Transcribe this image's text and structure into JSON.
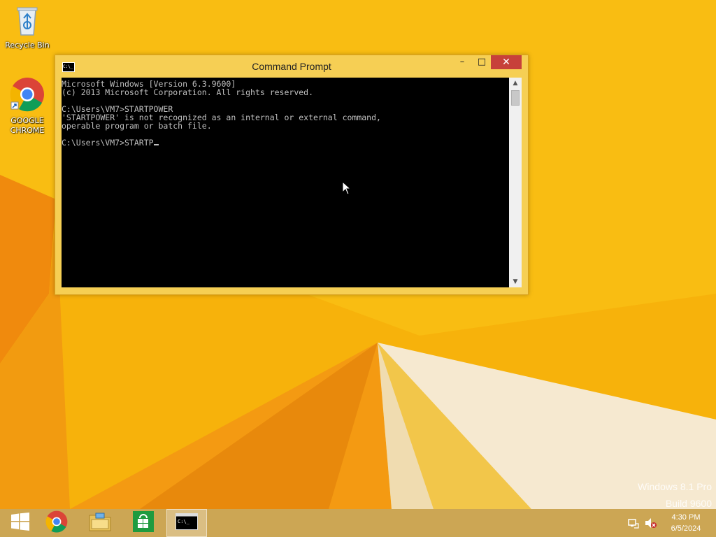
{
  "desktop": {
    "icons": [
      {
        "label": "Recycle Bin",
        "icon": "recycle-bin-icon"
      },
      {
        "label": "GOOGLE\nCHROME",
        "icon": "chrome-icon"
      }
    ],
    "watermark": {
      "line1": "Windows 8.1 Pro",
      "line2": "Build 9600"
    }
  },
  "window": {
    "title": "Command Prompt",
    "icon": "cmd-icon",
    "controls": {
      "minimize": "–",
      "maximize": "□",
      "close": "✕"
    },
    "console_text": "Microsoft Windows [Version 6.3.9600]\n(c) 2013 Microsoft Corporation. All rights reserved.\n\nC:\\Users\\VM7>STARTPOWER\n'STARTPOWER' is not recognized as an internal or external command,\noperable program or batch file.\n\nC:\\Users\\VM7>STARTP",
    "colors": {
      "background": "#000000",
      "text": "#c0c0c0",
      "frame": "#f6cf54",
      "close": "#c7413a"
    }
  },
  "taskbar": {
    "items": [
      {
        "name": "start",
        "icon": "windows-start-icon"
      },
      {
        "name": "chrome",
        "icon": "chrome-icon"
      },
      {
        "name": "file-explorer",
        "icon": "folder-icon"
      },
      {
        "name": "store",
        "icon": "store-icon"
      },
      {
        "name": "command-prompt",
        "icon": "cmd-icon",
        "active": true
      }
    ],
    "tray": {
      "icons": [
        "network-icon",
        "speaker-muted-icon"
      ],
      "time": "4:30 PM",
      "date": "6/5/2024"
    }
  }
}
